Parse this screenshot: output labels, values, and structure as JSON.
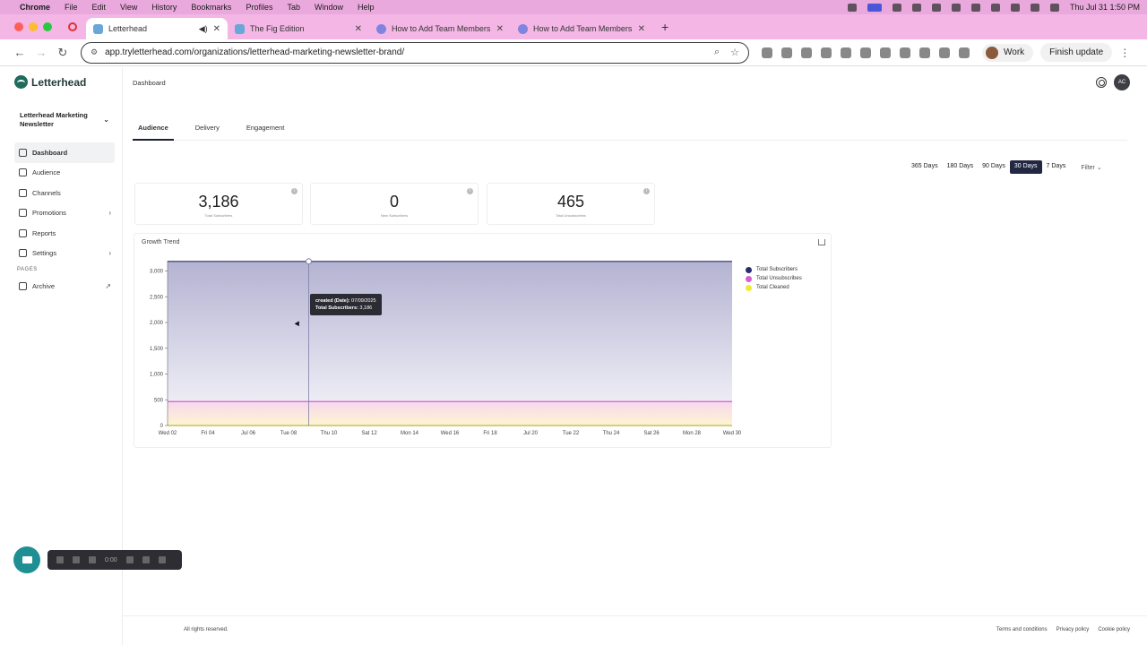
{
  "mac": {
    "menus": [
      "Chrome",
      "File",
      "Edit",
      "View",
      "History",
      "Bookmarks",
      "Profiles",
      "Tab",
      "Window",
      "Help"
    ],
    "datetime": "Thu Jul 31  1:50 PM"
  },
  "browser": {
    "tabs": [
      {
        "title": "Letterhead",
        "active": true
      },
      {
        "title": "The Fig Edition",
        "active": false
      },
      {
        "title": "How to Add Team Members t",
        "active": false
      },
      {
        "title": "How to Add Team Members t",
        "active": false
      }
    ],
    "url": "app.tryletterhead.com/organizations/letterhead-marketing-newsletter-brand/",
    "profile": "Work",
    "finish_update": "Finish update"
  },
  "app": {
    "brand": "Letterhead",
    "org": "Letterhead Marketing Newsletter",
    "nav": [
      {
        "label": "Dashboard",
        "active": true,
        "icon": "home-icon"
      },
      {
        "label": "Audience",
        "icon": "users-icon"
      },
      {
        "label": "Channels",
        "icon": "channels-icon"
      },
      {
        "label": "Promotions",
        "icon": "megaphone-icon",
        "expandable": true
      },
      {
        "label": "Reports",
        "icon": "reports-icon"
      },
      {
        "label": "Settings",
        "icon": "settings-icon",
        "expandable": true
      }
    ],
    "pages_section": "PAGES",
    "pages": [
      {
        "label": "Archive",
        "icon": "archive-icon"
      }
    ],
    "page_title": "Dashboard",
    "user_initials": "AC",
    "tabs": [
      "Audience",
      "Delivery",
      "Engagement"
    ],
    "ranges": [
      "365 Days",
      "180 Days",
      "90 Days",
      "30 Days",
      "7 Days"
    ],
    "active_range": "30 Days",
    "filter": "Filter",
    "stats": [
      {
        "value": "3,186",
        "label": "Total Subscribers"
      },
      {
        "value": "0",
        "label": "New Subscribers"
      },
      {
        "value": "465",
        "label": "Total Unsubscribes"
      }
    ],
    "chart_card_title": "Growth Trend",
    "tooltip": {
      "line1_label": "created (Date):",
      "line1_value": "07/09/2025",
      "line2_label": "Total Subscribers:",
      "line2_value": "3,186"
    },
    "footer": {
      "copyright": "All rights reserved.",
      "links": [
        "Terms and conditions",
        "Privacy policy",
        "Cookie policy"
      ]
    },
    "recorder_time": "0:00"
  },
  "chart_data": {
    "type": "area",
    "title": "Growth Trend",
    "x": [
      "Wed 02",
      "Fri 04",
      "Jul 06",
      "Tue 08",
      "Thu 10",
      "Sat 12",
      "Mon 14",
      "Wed 16",
      "Fri 18",
      "Jul 20",
      "Tue 22",
      "Thu 24",
      "Sat 26",
      "Mon 28",
      "Wed 30"
    ],
    "ylim": [
      0,
      3200
    ],
    "yticks": [
      0,
      500,
      1000,
      1500,
      2000,
      2500,
      3000
    ],
    "ytick_labels": [
      "0",
      "500",
      "1,000",
      "1,500",
      "2,000",
      "2,500",
      "3,000"
    ],
    "series": [
      {
        "name": "Total Subscribers",
        "color": "#2a2d6b",
        "values": [
          3186,
          3186,
          3186,
          3186,
          3186,
          3186,
          3186,
          3186,
          3186,
          3186,
          3186,
          3186,
          3186,
          3186,
          3186
        ]
      },
      {
        "name": "Total Unsubscribes",
        "color": "#d95cd0",
        "values": [
          465,
          465,
          465,
          465,
          465,
          465,
          465,
          465,
          465,
          465,
          465,
          465,
          465,
          465,
          465
        ]
      },
      {
        "name": "Total Cleaned",
        "color": "#f2ea2e",
        "values": [
          0,
          0,
          0,
          0,
          0,
          0,
          0,
          0,
          0,
          0,
          0,
          0,
          0,
          0,
          0
        ]
      }
    ],
    "legend": "right",
    "grid": false
  }
}
